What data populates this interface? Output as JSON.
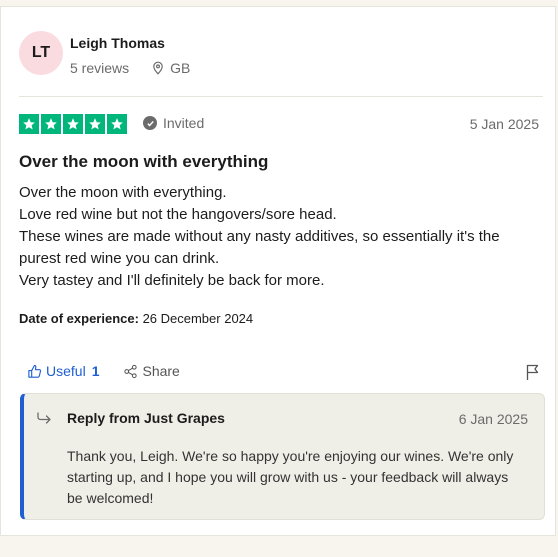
{
  "reviewer": {
    "initials": "LT",
    "name": "Leigh Thomas",
    "reviews": "5 reviews",
    "country": "GB"
  },
  "rating": {
    "stars": 5,
    "max": 5,
    "color": "#00b67a"
  },
  "badge": {
    "label": "Invited"
  },
  "review": {
    "date": "5 Jan 2025",
    "title": "Over the moon with everything",
    "lines": [
      "Over the moon with everything.",
      "Love red wine but not the hangovers/sore head.",
      "These wines are made without any nasty additives, so essentially it's the purest red wine you can drink.",
      "Very tastey and I'll definitely be back for more."
    ],
    "experience_label": "Date of experience:",
    "experience_date": "26 December 2024"
  },
  "actions": {
    "useful_label": "Useful",
    "useful_count": "1",
    "share_label": "Share"
  },
  "reply": {
    "title": "Reply from Just Grapes",
    "date": "6 Jan 2025",
    "body": "Thank you, Leigh. We're so happy you're enjoying our wines. We're only starting up, and I hope you will grow with us - your feedback will always be welcomed!"
  },
  "colors": {
    "accent": "#1f5fd1",
    "avatar_bg": "#fadbe0",
    "reply_bg": "#f0efe7"
  }
}
